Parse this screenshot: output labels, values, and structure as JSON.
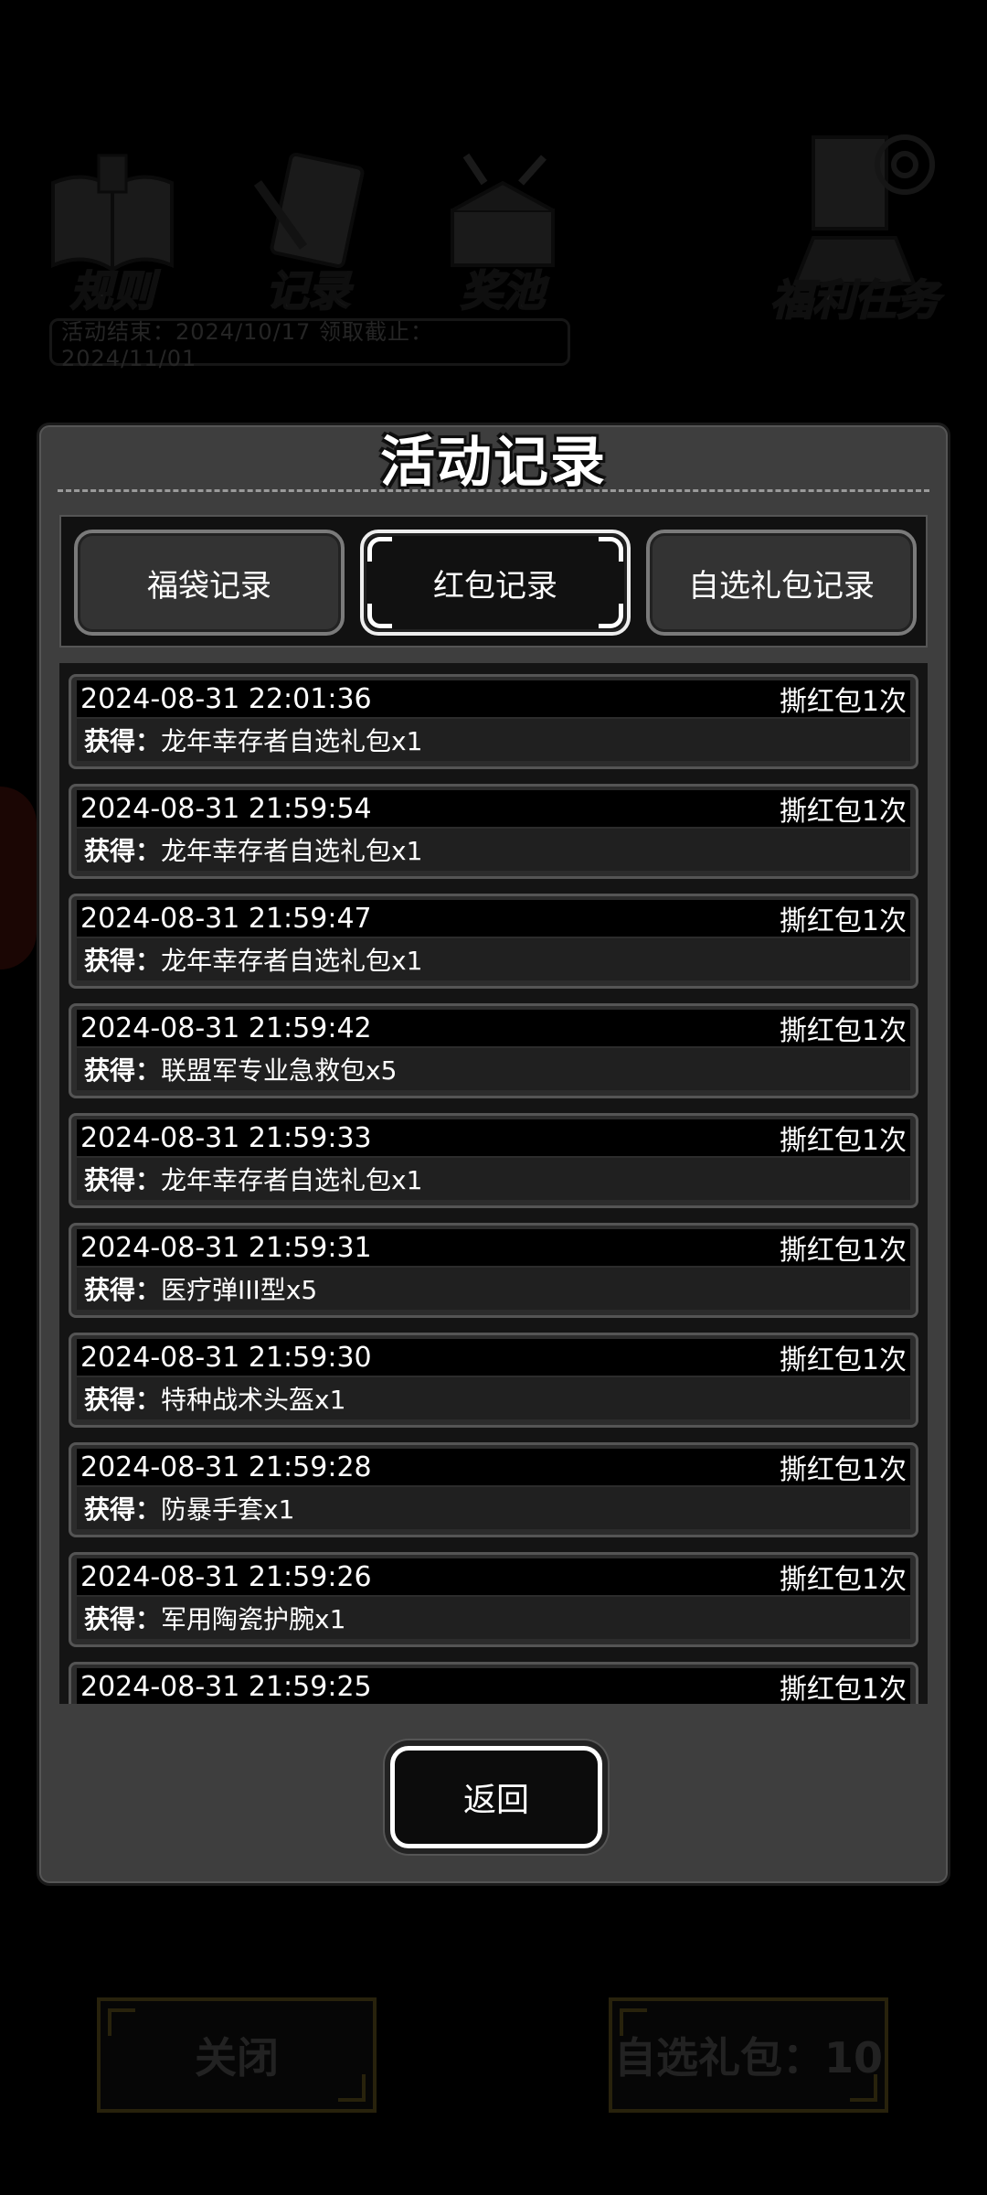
{
  "background": {
    "icons": [
      {
        "name": "rules",
        "label": "规则"
      },
      {
        "name": "records",
        "label": "记录"
      },
      {
        "name": "prize-pool",
        "label": "奖池"
      },
      {
        "name": "welfare-tasks",
        "label": "福利任务"
      }
    ],
    "dates_text": "活动结束：2024/10/17  领取截止：2024/11/01",
    "close_label": "关闭",
    "optional_gift_label": "自选礼包：10"
  },
  "modal": {
    "title": "活动记录",
    "tabs": [
      {
        "label": "福袋记录",
        "active": false
      },
      {
        "label": "红包记录",
        "active": true
      },
      {
        "label": "自选礼包记录",
        "active": false
      }
    ],
    "obtained_label": "获得：",
    "records": [
      {
        "time": "2024-08-31 22:01:36",
        "type": "撕红包1次",
        "item": "龙年幸存者自选礼包x1"
      },
      {
        "time": "2024-08-31 21:59:54",
        "type": "撕红包1次",
        "item": "龙年幸存者自选礼包x1"
      },
      {
        "time": "2024-08-31 21:59:47",
        "type": "撕红包1次",
        "item": "龙年幸存者自选礼包x1"
      },
      {
        "time": "2024-08-31 21:59:42",
        "type": "撕红包1次",
        "item": "联盟军专业急救包x5"
      },
      {
        "time": "2024-08-31 21:59:33",
        "type": "撕红包1次",
        "item": "龙年幸存者自选礼包x1"
      },
      {
        "time": "2024-08-31 21:59:31",
        "type": "撕红包1次",
        "item": "医疗弹III型x5"
      },
      {
        "time": "2024-08-31 21:59:30",
        "type": "撕红包1次",
        "item": "特种战术头盔x1"
      },
      {
        "time": "2024-08-31 21:59:28",
        "type": "撕红包1次",
        "item": "防暴手套x1"
      },
      {
        "time": "2024-08-31 21:59:26",
        "type": "撕红包1次",
        "item": "军用陶瓷护腕x1"
      },
      {
        "time": "2024-08-31 21:59:25",
        "type": "撕红包1次",
        "item": ""
      }
    ],
    "back_label": "返回"
  }
}
